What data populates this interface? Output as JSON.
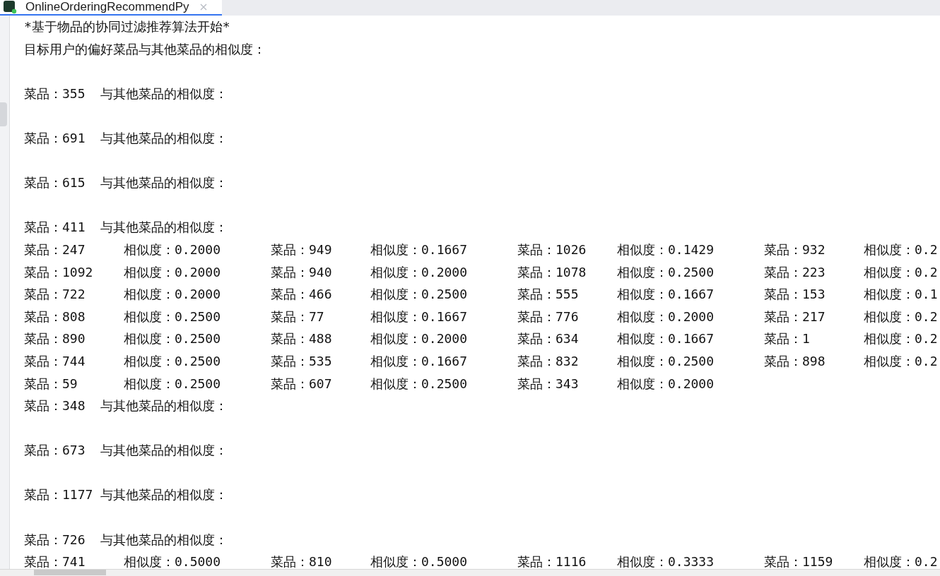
{
  "tab": {
    "title": "OnlineOrderingRecommendPy",
    "selected": true
  },
  "console": {
    "lines": [
      {
        "kind": "text",
        "text": "*基于物品的协同过滤推荐算法开始*"
      },
      {
        "kind": "text",
        "text": "目标用户的偏好菜品与其他菜品的相似度："
      },
      {
        "kind": "blank"
      },
      {
        "kind": "text",
        "text": "菜品：355  与其他菜品的相似度："
      },
      {
        "kind": "blank"
      },
      {
        "kind": "text",
        "text": "菜品：691  与其他菜品的相似度："
      },
      {
        "kind": "blank"
      },
      {
        "kind": "text",
        "text": "菜品：615  与其他菜品的相似度："
      },
      {
        "kind": "blank"
      },
      {
        "kind": "text",
        "text": "菜品：411  与其他菜品的相似度："
      },
      {
        "kind": "pairs",
        "cells": [
          {
            "dish": "菜品：247",
            "similarity": "相似度：0.2000"
          },
          {
            "dish": "菜品：949",
            "similarity": "相似度：0.1667"
          },
          {
            "dish": "菜品：1026",
            "similarity": "相似度：0.1429"
          },
          {
            "dish": "菜品：932",
            "similarity": "相似度：0.2"
          }
        ]
      },
      {
        "kind": "pairs",
        "cells": [
          {
            "dish": "菜品：1092",
            "similarity": "相似度：0.2000"
          },
          {
            "dish": "菜品：940",
            "similarity": "相似度：0.2000"
          },
          {
            "dish": "菜品：1078",
            "similarity": "相似度：0.2500"
          },
          {
            "dish": "菜品：223",
            "similarity": "相似度：0.2"
          }
        ]
      },
      {
        "kind": "pairs",
        "cells": [
          {
            "dish": "菜品：722",
            "similarity": "相似度：0.2000"
          },
          {
            "dish": "菜品：466",
            "similarity": "相似度：0.2500"
          },
          {
            "dish": "菜品：555",
            "similarity": "相似度：0.1667"
          },
          {
            "dish": "菜品：153",
            "similarity": "相似度：0.1"
          }
        ]
      },
      {
        "kind": "pairs",
        "cells": [
          {
            "dish": "菜品：808",
            "similarity": "相似度：0.2500"
          },
          {
            "dish": "菜品：77",
            "similarity": "相似度：0.1667"
          },
          {
            "dish": "菜品：776",
            "similarity": "相似度：0.2000"
          },
          {
            "dish": "菜品：217",
            "similarity": "相似度：0.2"
          }
        ]
      },
      {
        "kind": "pairs",
        "cells": [
          {
            "dish": "菜品：890",
            "similarity": "相似度：0.2500"
          },
          {
            "dish": "菜品：488",
            "similarity": "相似度：0.2000"
          },
          {
            "dish": "菜品：634",
            "similarity": "相似度：0.1667"
          },
          {
            "dish": "菜品：1",
            "similarity": "相似度：0.2"
          }
        ]
      },
      {
        "kind": "pairs",
        "cells": [
          {
            "dish": "菜品：744",
            "similarity": "相似度：0.2500"
          },
          {
            "dish": "菜品：535",
            "similarity": "相似度：0.1667"
          },
          {
            "dish": "菜品：832",
            "similarity": "相似度：0.2500"
          },
          {
            "dish": "菜品：898",
            "similarity": "相似度：0.2"
          }
        ]
      },
      {
        "kind": "pairs",
        "cells": [
          {
            "dish": "菜品：59",
            "similarity": "相似度：0.2500"
          },
          {
            "dish": "菜品：607",
            "similarity": "相似度：0.2500"
          },
          {
            "dish": "菜品：343",
            "similarity": "相似度：0.2000"
          }
        ]
      },
      {
        "kind": "text",
        "text": "菜品：348  与其他菜品的相似度："
      },
      {
        "kind": "blank"
      },
      {
        "kind": "text",
        "text": "菜品：673  与其他菜品的相似度："
      },
      {
        "kind": "blank"
      },
      {
        "kind": "text",
        "text": "菜品：1177 与其他菜品的相似度："
      },
      {
        "kind": "blank"
      },
      {
        "kind": "text",
        "text": "菜品：726  与其他菜品的相似度："
      },
      {
        "kind": "pairs",
        "cells": [
          {
            "dish": "菜品：741",
            "similarity": "相似度：0.5000"
          },
          {
            "dish": "菜品：810",
            "similarity": "相似度：0.5000"
          },
          {
            "dish": "菜品：1116",
            "similarity": "相似度：0.3333"
          },
          {
            "dish": "菜品：1159",
            "similarity": "相似度：0.2"
          }
        ]
      }
    ]
  }
}
